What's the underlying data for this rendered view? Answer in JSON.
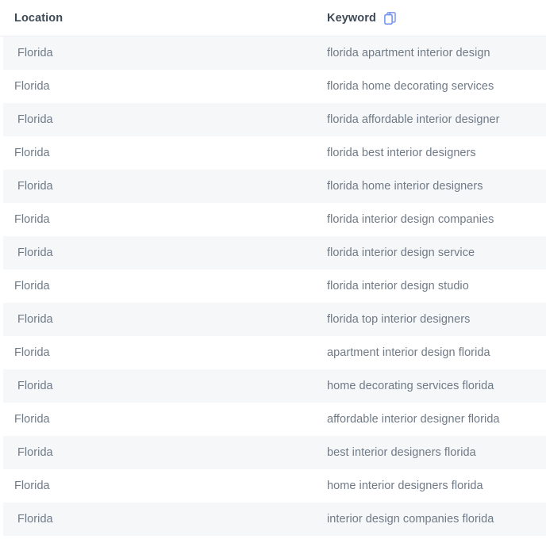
{
  "table": {
    "columns": [
      {
        "key": "location",
        "label": "Location"
      },
      {
        "key": "keyword",
        "label": "Keyword"
      }
    ],
    "header_icon": {
      "name": "copy-icon",
      "color": "#6b8ff0"
    },
    "rows": [
      {
        "location": "Florida",
        "keyword": "florida apartment interior design"
      },
      {
        "location": "Florida",
        "keyword": "florida home decorating services"
      },
      {
        "location": "Florida",
        "keyword": "florida affordable interior designer"
      },
      {
        "location": "Florida",
        "keyword": "florida best interior designers"
      },
      {
        "location": "Florida",
        "keyword": "florida home interior designers"
      },
      {
        "location": "Florida",
        "keyword": "florida interior design companies"
      },
      {
        "location": "Florida",
        "keyword": "florida interior design service"
      },
      {
        "location": "Florida",
        "keyword": "florida interior design studio"
      },
      {
        "location": "Florida",
        "keyword": "florida top interior designers"
      },
      {
        "location": "Florida",
        "keyword": "apartment interior design florida"
      },
      {
        "location": "Florida",
        "keyword": "home decorating services florida"
      },
      {
        "location": "Florida",
        "keyword": "affordable interior designer florida"
      },
      {
        "location": "Florida",
        "keyword": "best interior designers florida"
      },
      {
        "location": "Florida",
        "keyword": "home interior designers florida"
      },
      {
        "location": "Florida",
        "keyword": "interior design companies florida"
      }
    ]
  },
  "colors": {
    "row_alt_background": "#f6f7f9",
    "row_background": "#ffffff",
    "header_text": "#3f4a57",
    "body_text": "#6f7a87",
    "divider": "#eceef1",
    "icon_blue": "#6b8ff0"
  }
}
